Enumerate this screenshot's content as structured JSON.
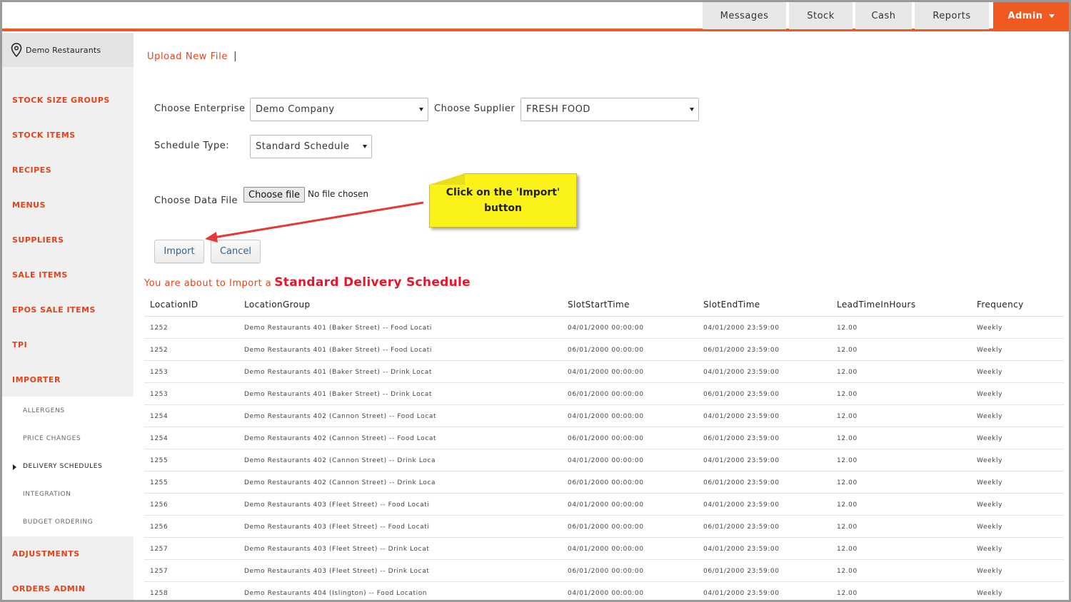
{
  "topnav": {
    "items": [
      {
        "label": "Messages"
      },
      {
        "label": "Stock"
      },
      {
        "label": "Cash"
      },
      {
        "label": "Reports"
      }
    ],
    "admin_label": "Admin"
  },
  "sidebar": {
    "location": "Demo Restaurants",
    "items": [
      {
        "label": "STOCK SIZE GROUPS"
      },
      {
        "label": "STOCK ITEMS"
      },
      {
        "label": "RECIPES"
      },
      {
        "label": "MENUS"
      },
      {
        "label": "SUPPLIERS"
      },
      {
        "label": "SALE ITEMS"
      },
      {
        "label": "EPOS SALE ITEMS"
      },
      {
        "label": "TPI"
      },
      {
        "label": "IMPORTER"
      }
    ],
    "subitems": [
      {
        "label": "ALLERGENS"
      },
      {
        "label": "PRICE CHANGES"
      },
      {
        "label": "DELIVERY SCHEDULES"
      },
      {
        "label": "INTEGRATION"
      },
      {
        "label": "BUDGET ORDERING"
      }
    ],
    "bottom_items": [
      {
        "label": "ADJUSTMENTS"
      },
      {
        "label": "ORDERS ADMIN"
      }
    ]
  },
  "main": {
    "upload_link": "Upload New File",
    "pipe": "|",
    "enterprise_label": "Choose Enterprise",
    "enterprise_value": "Demo Company",
    "supplier_label": "Choose Supplier",
    "supplier_value": "FRESH FOOD",
    "schedule_label": "Schedule Type:",
    "schedule_value": "Standard Schedule",
    "datafile_label": "Choose Data File",
    "file_button": "Choose file",
    "file_status": "No file chosen",
    "import_button": "Import",
    "cancel_button": "Cancel",
    "notice_prefix": "You are about to Import a",
    "notice_highlight": "Standard Delivery Schedule"
  },
  "callout": {
    "text": "Click on the 'Import' button"
  },
  "table": {
    "headers": [
      "LocationID",
      "LocationGroup",
      "SlotStartTime",
      "SlotEndTime",
      "LeadTimeInHours",
      "Frequency"
    ],
    "rows": [
      [
        "1252",
        "Demo Restaurants 401 (Baker Street) -- Food Locati",
        "04/01/2000 00:00:00",
        "04/01/2000 23:59:00",
        "12.00",
        "Weekly"
      ],
      [
        "1252",
        "Demo Restaurants 401 (Baker Street) -- Food Locati",
        "06/01/2000 00:00:00",
        "06/01/2000 23:59:00",
        "12.00",
        "Weekly"
      ],
      [
        "1253",
        "Demo Restaurants 401 (Baker Street) -- Drink Locat",
        "04/01/2000 00:00:00",
        "04/01/2000 23:59:00",
        "12.00",
        "Weekly"
      ],
      [
        "1253",
        "Demo Restaurants 401 (Baker Street) -- Drink Locat",
        "06/01/2000 00:00:00",
        "06/01/2000 23:59:00",
        "12.00",
        "Weekly"
      ],
      [
        "1254",
        "Demo Restaurants 402 (Cannon Street) -- Food Locat",
        "04/01/2000 00:00:00",
        "04/01/2000 23:59:00",
        "12.00",
        "Weekly"
      ],
      [
        "1254",
        "Demo Restaurants 402 (Cannon Street) -- Food Locat",
        "06/01/2000 00:00:00",
        "06/01/2000 23:59:00",
        "12.00",
        "Weekly"
      ],
      [
        "1255",
        "Demo Restaurants 402 (Cannon Street) -- Drink Loca",
        "04/01/2000 00:00:00",
        "04/01/2000 23:59:00",
        "12.00",
        "Weekly"
      ],
      [
        "1255",
        "Demo Restaurants 402 (Cannon Street) -- Drink Loca",
        "06/01/2000 00:00:00",
        "06/01/2000 23:59:00",
        "12.00",
        "Weekly"
      ],
      [
        "1256",
        "Demo Restaurants 403 (Fleet Street) -- Food Locati",
        "04/01/2000 00:00:00",
        "04/01/2000 23:59:00",
        "12.00",
        "Weekly"
      ],
      [
        "1256",
        "Demo Restaurants 403 (Fleet Street) -- Food Locati",
        "06/01/2000 00:00:00",
        "06/01/2000 23:59:00",
        "12.00",
        "Weekly"
      ],
      [
        "1257",
        "Demo Restaurants 403 (Fleet Street) -- Drink Locat",
        "04/01/2000 00:00:00",
        "04/01/2000 23:59:00",
        "12.00",
        "Weekly"
      ],
      [
        "1257",
        "Demo Restaurants 403 (Fleet Street) -- Drink Locat",
        "06/01/2000 00:00:00",
        "06/01/2000 23:59:00",
        "12.00",
        "Weekly"
      ],
      [
        "1258",
        "Demo Restaurants 404 (Islington) -- Food Location",
        "04/01/2000 00:00:00",
        "04/01/2000 23:59:00",
        "12.00",
        "Weekly"
      ]
    ]
  },
  "colors": {
    "accent": "#f05a22",
    "menu_text": "#e2431a",
    "callout": "#fbf219",
    "arrow": "#e53935"
  }
}
